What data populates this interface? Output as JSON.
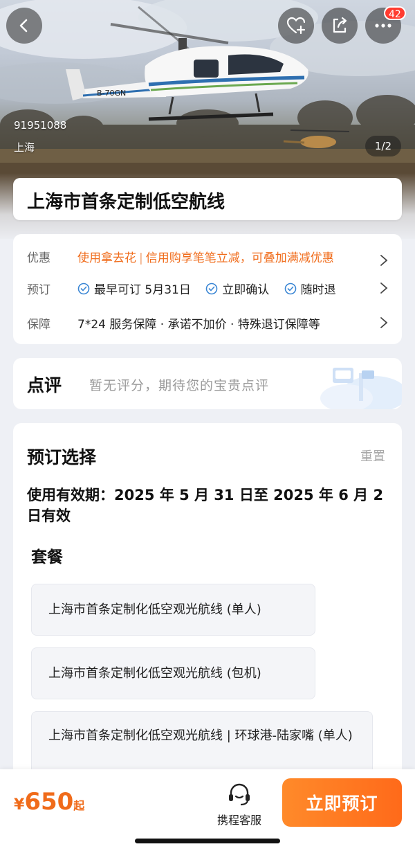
{
  "hero": {
    "product_id": "91951088",
    "city": "上海",
    "pager": "1/2",
    "helicopter_reg": "B-70GN",
    "notification_count": "42"
  },
  "title": "上海市首条定制低空航线",
  "info": {
    "discount": {
      "label": "优惠",
      "text_1": "使用拿去花",
      "text_2": "信用购享笔笔立减，可叠加满减优惠"
    },
    "booking": {
      "label": "预订",
      "items": [
        "最早可订 5月31日",
        "立即确认",
        "随时退"
      ]
    },
    "guarantee": {
      "label": "保障",
      "text": "7*24 服务保障 · 承诺不加价 · 特殊退订保障等"
    }
  },
  "review": {
    "title": "点评",
    "empty_text": "暂无评分，期待您的宝贵点评"
  },
  "booking_select": {
    "title": "预订选择",
    "reset": "重置",
    "validity": "使用有效期：2025 年 5 月 31 日至 2025 年 6 月 2 日有效",
    "package_title": "套餐",
    "packages": [
      "上海市首条定制化低空观光航线 (单人)",
      "上海市首条定制化低空观光航线 (包机)",
      "上海市首条定制化低空观光航线 | 环球港-陆家嘴 (单人)"
    ]
  },
  "bottom": {
    "currency": "¥",
    "price": "650",
    "price_suffix": "起",
    "service_label": "携程客服",
    "book_label": "立即预订"
  },
  "colors": {
    "accent": "#f06b1a",
    "check": "#3a86d4",
    "badge": "#ff3b30"
  }
}
